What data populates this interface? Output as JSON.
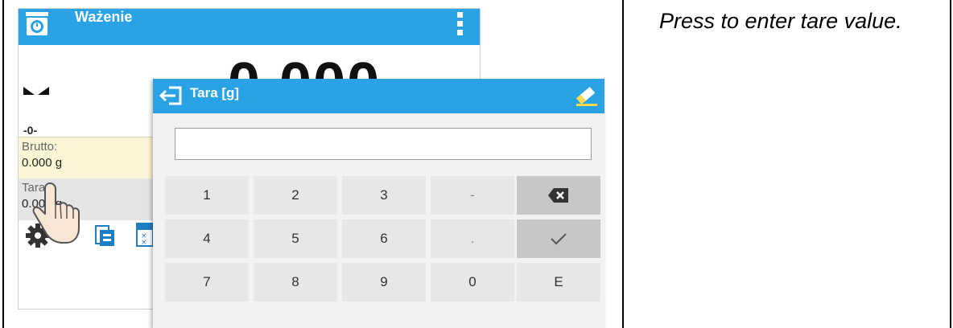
{
  "caption": "Press to enter tare value.",
  "background_screen": {
    "title": "Ważenie",
    "reading": "0.000",
    "zero_indicator": "-0-",
    "brutto": {
      "label": "Brutto:",
      "value": "0.000 g"
    },
    "tara": {
      "label": "Tara:",
      "value": "0.000 g"
    }
  },
  "dialog": {
    "title": "Tara [g]",
    "input_value": "",
    "keys": {
      "k1": "1",
      "k2": "2",
      "k3": "3",
      "minus": "-",
      "k4": "4",
      "k5": "5",
      "k6": "6",
      "dot": ".",
      "k7": "7",
      "k8": "8",
      "k9": "9",
      "k0": "0",
      "exp": "E"
    }
  },
  "colors": {
    "header_blue": "#29a3e6",
    "brutto_bg": "#fdf6d6",
    "tara_bg": "#e5e5e5",
    "key_bg": "#e7e7e7",
    "key_dark_bg": "#c7c7c7"
  },
  "icons": [
    "scale-icon",
    "menu-dots-icon",
    "stability-icon",
    "gear-icon",
    "weighing-icon",
    "calculator-icon",
    "hand-pointer-icon",
    "back-icon",
    "eraser-icon",
    "backspace-icon",
    "checkmark-icon"
  ]
}
